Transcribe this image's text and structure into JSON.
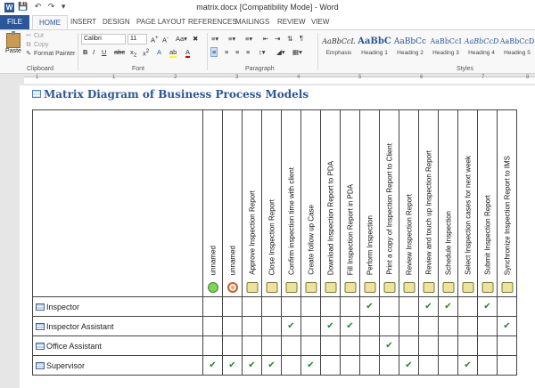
{
  "window": {
    "title": "matrix.docx [Compatibility Mode] - Word",
    "app_icon": "W",
    "qat": [
      "save-icon",
      "undo-icon",
      "redo-icon",
      "customize-icon"
    ]
  },
  "tabs": [
    "FILE",
    "HOME",
    "INSERT",
    "DESIGN",
    "PAGE LAYOUT",
    "REFERENCES",
    "MAILINGS",
    "REVIEW",
    "VIEW"
  ],
  "active_tab": "HOME",
  "ribbon": {
    "clipboard": {
      "paste": "Paste",
      "cut": "Cut",
      "copy": "Copy",
      "format_painter": "Format Painter",
      "label": "Clipboard"
    },
    "font": {
      "name": "Calibri",
      "size": "11",
      "label": "Font"
    },
    "paragraph": {
      "label": "Paragraph"
    },
    "styles": {
      "label": "Styles",
      "items": [
        {
          "sample": "AaBbCcL",
          "name": "Emphasis"
        },
        {
          "sample": "AaBbC",
          "name": "Heading 1"
        },
        {
          "sample": "AaBbCc",
          "name": "Heading 2"
        },
        {
          "sample": "AaBbCcI",
          "name": "Heading 3"
        },
        {
          "sample": "AaBbCcD",
          "name": "Heading 4"
        },
        {
          "sample": "AaBbCcD",
          "name": "Heading 5"
        }
      ]
    }
  },
  "ruler": {
    "numbers": [
      "1",
      "1",
      "2",
      "3",
      "4",
      "5",
      "6",
      "7",
      "8"
    ]
  },
  "document": {
    "title": "Matrix Diagram of Business Process Models",
    "columns": [
      {
        "label": "unnamed",
        "marker": "circle-green"
      },
      {
        "label": "unnamed",
        "marker": "circle-orange"
      },
      {
        "label": "Approve Inspection Report",
        "marker": "box"
      },
      {
        "label": "Close Inspection Report",
        "marker": "box"
      },
      {
        "label": "Confirm inspection time with client",
        "marker": "box"
      },
      {
        "label": "Create follow up Case",
        "marker": "box"
      },
      {
        "label": "Download Inspection Report to PDA",
        "marker": "box"
      },
      {
        "label": "Fill Inspection Report in PDA",
        "marker": "box"
      },
      {
        "label": "Perform Inspection",
        "marker": "box"
      },
      {
        "label": "Print a copy of Inspection Report to Client",
        "marker": "box"
      },
      {
        "label": "Review Inspection Report",
        "marker": "box"
      },
      {
        "label": "Review and touch up Inspection Report",
        "marker": "box"
      },
      {
        "label": "Schedule Inspection",
        "marker": "box"
      },
      {
        "label": "Select Inspection cases for next week",
        "marker": "box"
      },
      {
        "label": "Submit Inspection Report",
        "marker": "box"
      },
      {
        "label": "Synchronize Inspection Report to IMS",
        "marker": "box"
      }
    ],
    "check_symbol": "✔",
    "rows": [
      {
        "label": "Inspector",
        "checks": [
          8,
          11,
          12,
          14
        ]
      },
      {
        "label": "Inspector Assistant",
        "checks": [
          4,
          6,
          7,
          15
        ]
      },
      {
        "label": "Office Assistant",
        "checks": [
          9
        ]
      },
      {
        "label": "Supervisor",
        "checks": [
          0,
          1,
          2,
          3,
          5,
          10,
          13
        ]
      }
    ]
  }
}
